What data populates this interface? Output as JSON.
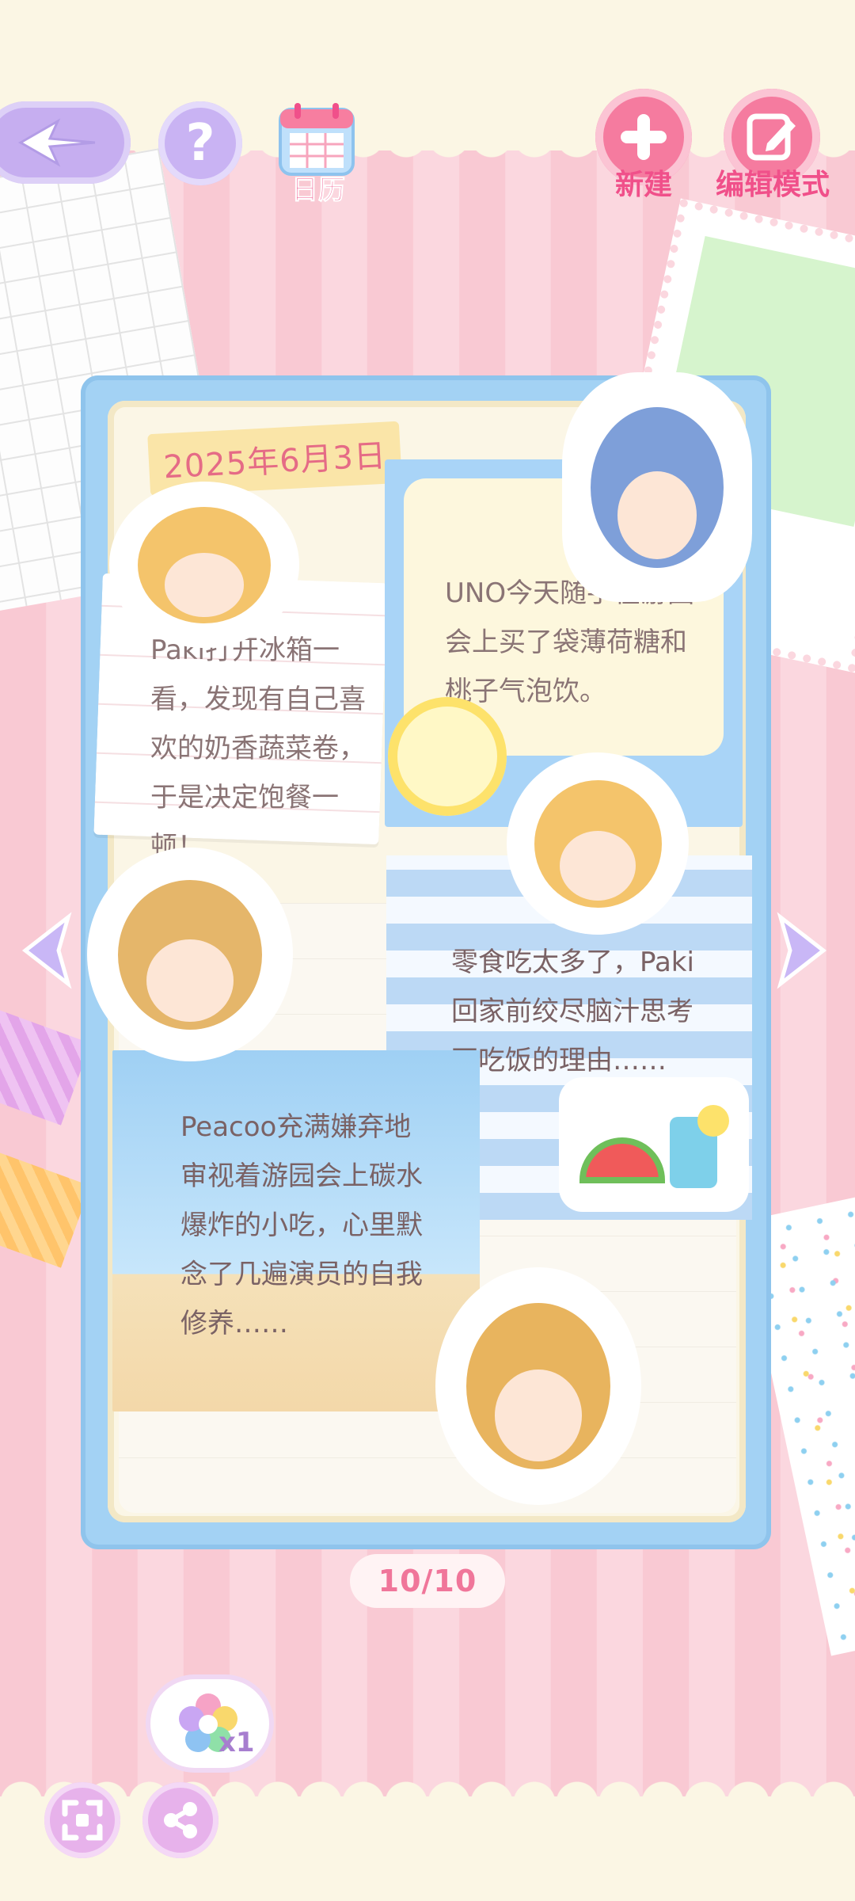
{
  "toolbar": {
    "calendar_label": "日历",
    "new_label": "新建",
    "edit_label": "编辑模式"
  },
  "diary": {
    "date": "2025年6月3日",
    "entries": [
      {
        "text": "Paki打开冰箱一看，发现有自己喜欢的奶香蔬菜卷，于是决定饱餐一顿！"
      },
      {
        "text": "UNO今天随手在游园会上买了袋薄荷糖和桃子气泡饮。"
      },
      {
        "text": "零食吃太多了，Paki回家前绞尽脑汁思考不吃饭的理由……"
      },
      {
        "text": "Peacoo充满嫌弃地审视着游园会上碳水爆炸的小吃，心里默念了几遍演员的自我修养……"
      }
    ]
  },
  "pagination": {
    "current": 10,
    "total": 10,
    "label": "10/10"
  },
  "bottom": {
    "gem_count": "x1"
  },
  "icons": {
    "back": "back-arrow-icon",
    "help": "question-icon",
    "calendar": "calendar-icon",
    "new": "plus-icon",
    "edit": "pencil-edit-icon",
    "prev": "left-arrow-icon",
    "next": "right-arrow-icon",
    "fullscreen": "fullscreen-icon",
    "share": "share-icon",
    "gem": "rainbow-flower-icon"
  },
  "colors": {
    "accent_pink": "#f57b9f",
    "label_pink": "#f0508a",
    "lavender": "#c6aef0",
    "book_blue": "#a3d2f4"
  }
}
